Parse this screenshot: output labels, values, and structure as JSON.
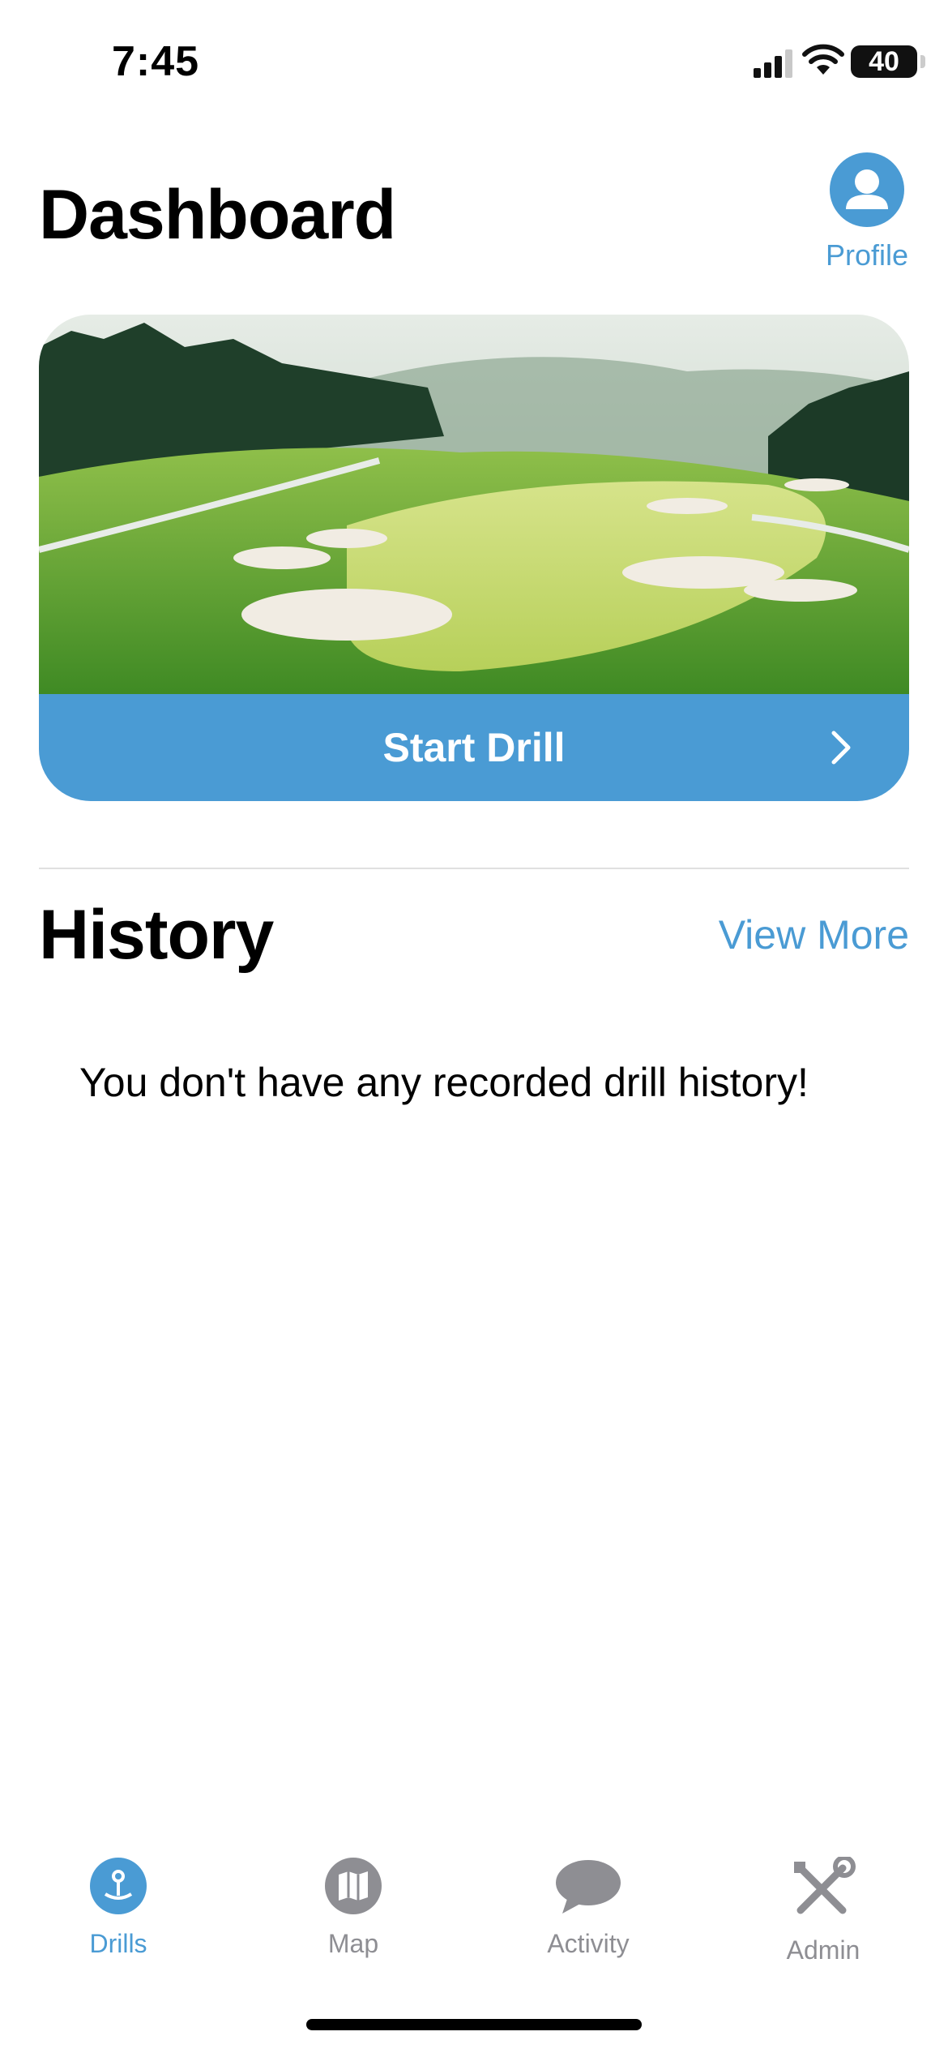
{
  "status_bar": {
    "time": "7:45",
    "battery": "40",
    "icons": [
      "signal-icon",
      "wifi-icon",
      "battery-icon"
    ]
  },
  "header": {
    "title": "Dashboard",
    "profile_label": "Profile",
    "profile_icon": "person-icon"
  },
  "hero": {
    "image": "golf-course-image",
    "button_label": "Start Drill",
    "button_icon": "chevron-right-icon"
  },
  "history": {
    "title": "History",
    "view_more": "View More",
    "empty_message": "You don't have any recorded drill history!"
  },
  "tabbar": {
    "items": [
      {
        "label": "Drills",
        "icon": "pin-icon",
        "active": true
      },
      {
        "label": "Map",
        "icon": "map-icon",
        "active": false
      },
      {
        "label": "Activity",
        "icon": "chat-bubble-icon",
        "active": false
      },
      {
        "label": "Admin",
        "icon": "tools-icon",
        "active": false
      }
    ]
  },
  "colors": {
    "accent": "#4a9bd4",
    "inactive": "#8e8e93"
  }
}
